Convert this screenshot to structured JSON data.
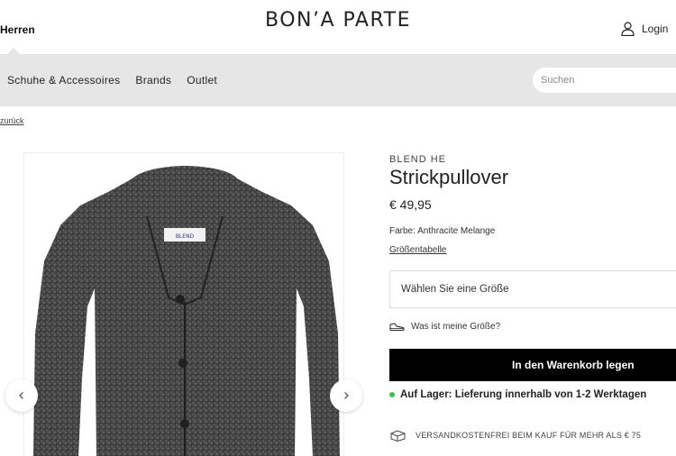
{
  "header": {
    "gender_tab": "Herren",
    "logo": "BON’A PARTE",
    "login_label": "Login"
  },
  "nav": {
    "items": [
      "Schuhe & Accessoires",
      "Brands",
      "Outlet"
    ],
    "search_placeholder": "Suchen"
  },
  "breadcrumb": {
    "back_label": "zurück"
  },
  "product": {
    "brand": "BLEND HE",
    "title": "Strickpullover",
    "price": "€ 49,95",
    "color_label": "Farbe: Anthracite Melange",
    "size_chart_link": "Größentabelle",
    "size_select_placeholder": "Wählen Sie eine Größe",
    "fit_help": "Was ist meine Größe?",
    "add_to_cart": "In den Warenkorb legen",
    "stock_status": "Auf Lager: Lieferung innerhalb von 1-2 Werktagen",
    "shipping_note": "VERSANDKOSTENFREI BEIM KAUF FÜR MEHR ALS € 75"
  },
  "image": {
    "label_text": "BLEND",
    "icons": [
      "chevron-left-icon",
      "chevron-right-icon",
      "user-icon",
      "shoe-icon",
      "shipping-box-icon"
    ]
  },
  "colors": {
    "navbar_bg": "#e6e6e6",
    "cart_button": "#000000",
    "stock_dot": "#3ac04a",
    "sweater": "#3d3d3d"
  }
}
